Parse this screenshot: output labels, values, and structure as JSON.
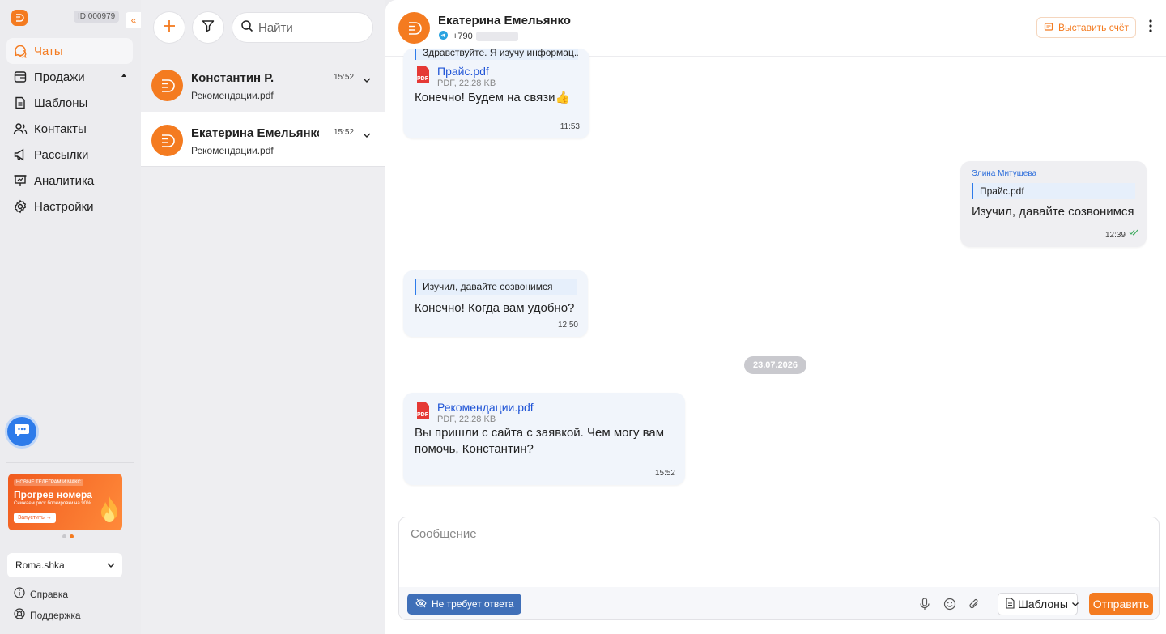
{
  "sidebar": {
    "account_id": "ID 000979",
    "collapse_icon": "«",
    "items": [
      {
        "label": "Чаты",
        "icon": "chat-icon",
        "active": true
      },
      {
        "label": "Продажи",
        "icon": "store-icon",
        "active": false
      },
      {
        "label": "Шаблоны",
        "icon": "document-icon",
        "active": false
      },
      {
        "label": "Контакты",
        "icon": "users-icon",
        "active": false
      },
      {
        "label": "Рассылки",
        "icon": "megaphone-icon",
        "active": false
      },
      {
        "label": "Аналитика",
        "icon": "presentation-chart-icon",
        "active": false
      },
      {
        "label": "Настройки",
        "icon": "gear-icon",
        "active": false
      }
    ],
    "promo": {
      "tag": "НОВЫЕ ТЕЛЕГРАМ И МАКС",
      "title": "Прогрев номера",
      "subtitle": "Снижаем риск блокировки на 90%",
      "button": "Запустить →"
    },
    "account_select": "Roma.shka",
    "help": "Справка",
    "support": "Поддержка"
  },
  "chatlist": {
    "search_placeholder": "Найти",
    "chats": [
      {
        "name": "Константин Р.",
        "time": "15:52",
        "preview": "Рекомендации.pdf"
      },
      {
        "name": "Екатерина Емельянко",
        "time": "15:52",
        "preview": "Рекомендации.pdf"
      }
    ]
  },
  "header": {
    "name": "Екатерина Емельянко",
    "phone_prefix": "+790",
    "invoice_button": "Выставить счёт"
  },
  "messages": {
    "m1": {
      "quote": "Здравствуйте. Я изучу информац...",
      "file_name": "Прайс.pdf",
      "file_meta": "PDF, 22.28 KB",
      "text": "Конечно! Будем на связи👍",
      "time": "11:53"
    },
    "m2": {
      "sender": "Элина Митушева",
      "quote": "Прайс.pdf",
      "text": "Изучил, давайте созвонимся",
      "time": "12:39"
    },
    "m3": {
      "quote": "Изучил, давайте созвонимся",
      "text": "Конечно! Когда вам удобно?",
      "time": "12:50"
    },
    "date": "23.07.2026",
    "m4": {
      "file_name": "Рекомендации.pdf",
      "file_meta": "PDF, 22.28 KB",
      "text": "Вы пришли с сайта с заявкой. Чем могу вам помочь, Константин?",
      "time": "15:52"
    }
  },
  "composer": {
    "placeholder": "Сообщение",
    "no_reply": "Не требует ответа",
    "templates": "Шаблоны",
    "send": "Отправить"
  },
  "colors": {
    "accent": "#F47B20",
    "link": "#1F54D6",
    "fab": "#2D7BEA"
  }
}
